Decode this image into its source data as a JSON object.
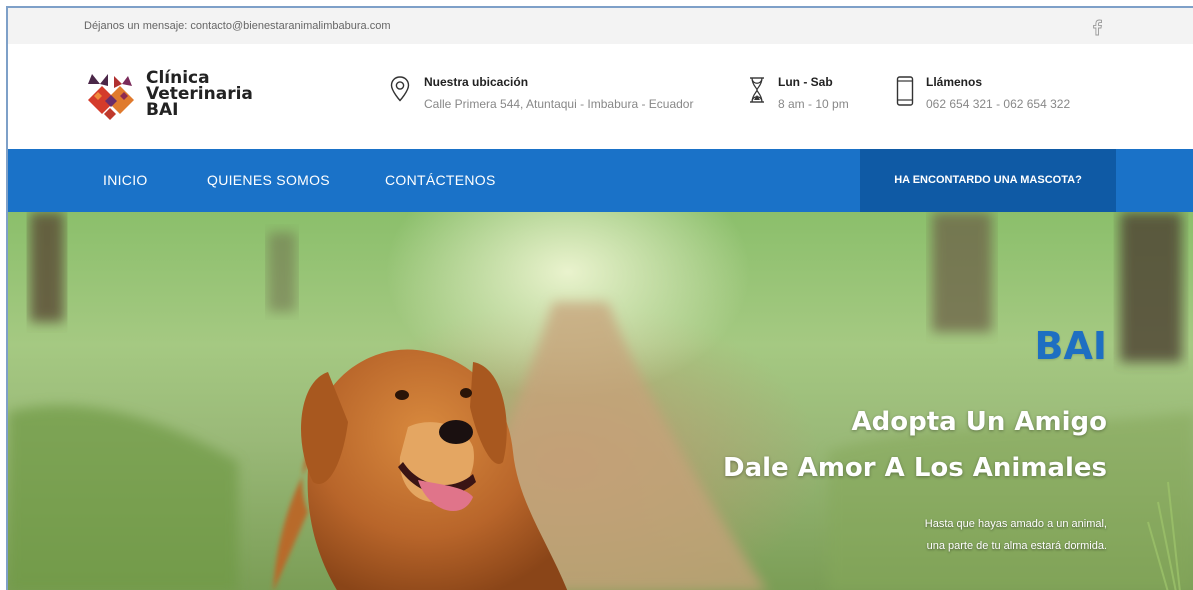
{
  "topbar": {
    "message": "Déjanos un mensaje: contacto@bienestaranimalimbabura.com",
    "social_icon": "facebook-icon"
  },
  "brand": {
    "line1": "Clínica",
    "line2": "Veterinaria",
    "line3": "BAI",
    "logo_icon": "cat-dog-logo"
  },
  "contact": {
    "location_title": "Nuestra ubicación",
    "location_value": "Calle Primera 544, Atuntaqui - Imbabura - Ecuador",
    "hours_title": "Lun - Sab",
    "hours_value": "8 am - 10 pm",
    "phone_title": "Llámenos",
    "phone_value": "062 654 321 - 062 654 322"
  },
  "nav": {
    "items": [
      "INICIO",
      "QUIENES SOMOS",
      "CONTÁCTENOS"
    ],
    "cta": "HA ENCONTARDO UNA MASCOTA?"
  },
  "hero": {
    "brand": "BAI",
    "headline1": "Adopta Un Amigo",
    "headline2": "Dale Amor A Los Animales",
    "subtext1": "Hasta que hayas amado a un animal,",
    "subtext2": "una parte de tu alma estará dormida."
  },
  "colors": {
    "nav": "#1a72c8",
    "cta": "#0f5aa5",
    "brand_blue": "#1e6fc2",
    "logo_red": "#d43b2b",
    "logo_orange": "#e07a2d",
    "logo_purple": "#6b2d6b"
  }
}
